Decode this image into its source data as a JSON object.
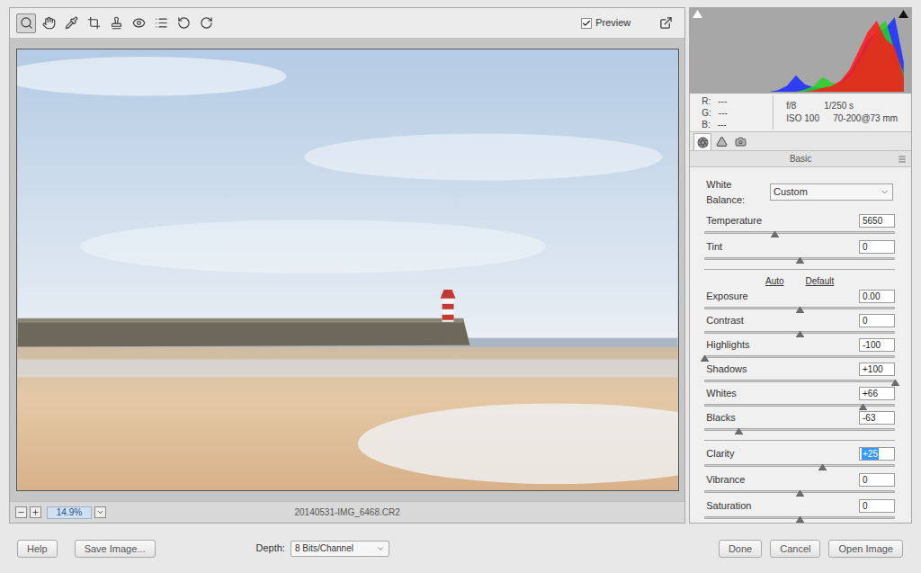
{
  "toolbar": {
    "tools": [
      {
        "selected": true
      },
      {
        "selected": false
      },
      {
        "selected": false
      },
      {
        "selected": false
      },
      {
        "selected": false
      },
      {
        "selected": false
      },
      {
        "selected": false
      },
      {
        "selected": false
      },
      {
        "selected": false
      }
    ],
    "preview": {
      "label": "Preview",
      "checked": true
    }
  },
  "photo": {
    "filename": "20140531-IMG_6468.CR2",
    "zoom": "14.9%"
  },
  "histogram": {
    "series": [
      {
        "color": "#1a2cff",
        "values": [
          0,
          0,
          0,
          0,
          0,
          0,
          0,
          0,
          0,
          2,
          8,
          22,
          10,
          6,
          5,
          8,
          12,
          25,
          45,
          70,
          80,
          85,
          100,
          40
        ]
      },
      {
        "color": "#22d422",
        "values": [
          0,
          0,
          0,
          0,
          0,
          0,
          0,
          0,
          0,
          0,
          0,
          0,
          3,
          8,
          20,
          12,
          10,
          20,
          40,
          60,
          85,
          95,
          55,
          25
        ]
      },
      {
        "color": "#ff1a1a",
        "values": [
          0,
          0,
          0,
          0,
          0,
          0,
          0,
          0,
          0,
          0,
          0,
          0,
          0,
          2,
          5,
          8,
          15,
          30,
          55,
          80,
          95,
          70,
          60,
          20
        ]
      }
    ]
  },
  "exif": {
    "rgb": [
      {
        "label": "R:",
        "value": "---"
      },
      {
        "label": "G:",
        "value": "---"
      },
      {
        "label": "B:",
        "value": "---"
      }
    ],
    "aperture": "f/8",
    "shutter": "1/250 s",
    "iso": "ISO 100",
    "lens": "70-200@73 mm"
  },
  "panel_tabs": [
    {
      "selected": true
    },
    {
      "selected": false
    },
    {
      "selected": false
    }
  ],
  "panel": {
    "title": "Basic",
    "white_balance": {
      "label": "White Balance:",
      "value": "Custom"
    },
    "groups": [
      {
        "links": [],
        "sliders": [
          {
            "label": "Temperature",
            "value": "5650",
            "level": 0.37,
            "focused": false
          },
          {
            "label": "Tint",
            "value": "0",
            "level": 0.5,
            "focused": false
          }
        ]
      },
      {
        "links": [
          "Auto",
          "Default"
        ],
        "sliders": [
          {
            "label": "Exposure",
            "value": "0.00",
            "level": 0.5,
            "focused": false
          },
          {
            "label": "Contrast",
            "value": "0",
            "level": 0.5,
            "focused": false
          },
          {
            "label": "Highlights",
            "value": "-100",
            "level": 0.0,
            "focused": false
          },
          {
            "label": "Shadows",
            "value": "+100",
            "level": 1.0,
            "focused": false
          },
          {
            "label": "Whites",
            "value": "+66",
            "level": 0.83,
            "focused": false
          },
          {
            "label": "Blacks",
            "value": "-63",
            "level": 0.18,
            "focused": false
          }
        ]
      },
      {
        "links": [],
        "sliders": [
          {
            "label": "Clarity",
            "value": "+25",
            "level": 0.62,
            "focused": true
          },
          {
            "label": "Vibrance",
            "value": "0",
            "level": 0.5,
            "focused": false
          },
          {
            "label": "Saturation",
            "value": "0",
            "level": 0.5,
            "focused": false
          }
        ]
      }
    ]
  },
  "bottom_bar": {
    "left_buttons": [
      "Help",
      "Save Image..."
    ],
    "depth": {
      "label": "Depth:",
      "value": "8 Bits/Channel"
    },
    "right_buttons": [
      "Done",
      "Cancel",
      "Open Image"
    ]
  }
}
